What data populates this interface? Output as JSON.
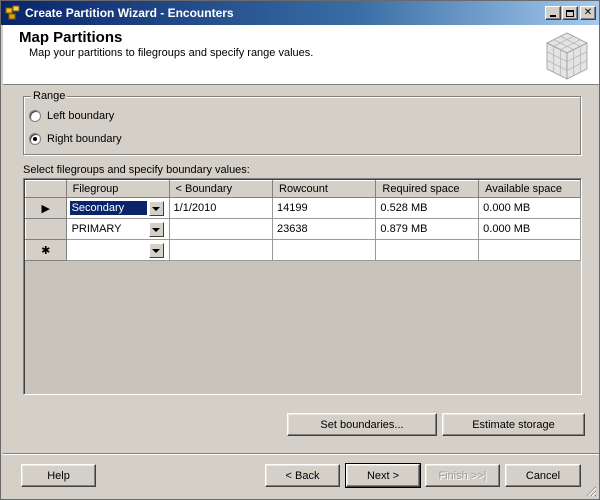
{
  "window": {
    "title": "Create Partition Wizard - Encounters",
    "controls": [
      "minimize-icon",
      "maximize-icon",
      "close-icon"
    ]
  },
  "header": {
    "title": "Map Partitions",
    "subtitle": "Map your partitions to filegroups and specify range values."
  },
  "range": {
    "legend": "Range",
    "options": [
      {
        "label": "Left boundary",
        "checked": false
      },
      {
        "label": "Right boundary",
        "checked": true
      }
    ]
  },
  "grid": {
    "label": "Select filegroups and specify boundary values:",
    "columns": [
      "Filegroup",
      "< Boundary",
      "Rowcount",
      "Required space",
      "Available space"
    ],
    "rows": [
      {
        "indicator": "▶",
        "filegroup": "Secondary",
        "boundary": "1/1/2010",
        "rowcount": "14199",
        "required": "0.528 MB",
        "available": "0.000 MB",
        "selected": true
      },
      {
        "indicator": "",
        "filegroup": "PRIMARY",
        "boundary": "",
        "rowcount": "23638",
        "required": "0.879 MB",
        "available": "0.000 MB",
        "selected": false
      },
      {
        "indicator": "✱",
        "filegroup": "",
        "boundary": "",
        "rowcount": "",
        "required": "",
        "available": "",
        "selected": false
      }
    ]
  },
  "actions": {
    "set_boundaries": "Set boundaries...",
    "estimate_storage": "Estimate storage"
  },
  "footer": {
    "help": "Help",
    "back": "< Back",
    "next": "Next >",
    "finish": "Finish >>|",
    "cancel": "Cancel"
  },
  "colors": {
    "titlebar_start": "#0a246a",
    "titlebar_end": "#a6caf0",
    "dialog_bg": "#d4d0c8",
    "selection": "#0a246a"
  }
}
